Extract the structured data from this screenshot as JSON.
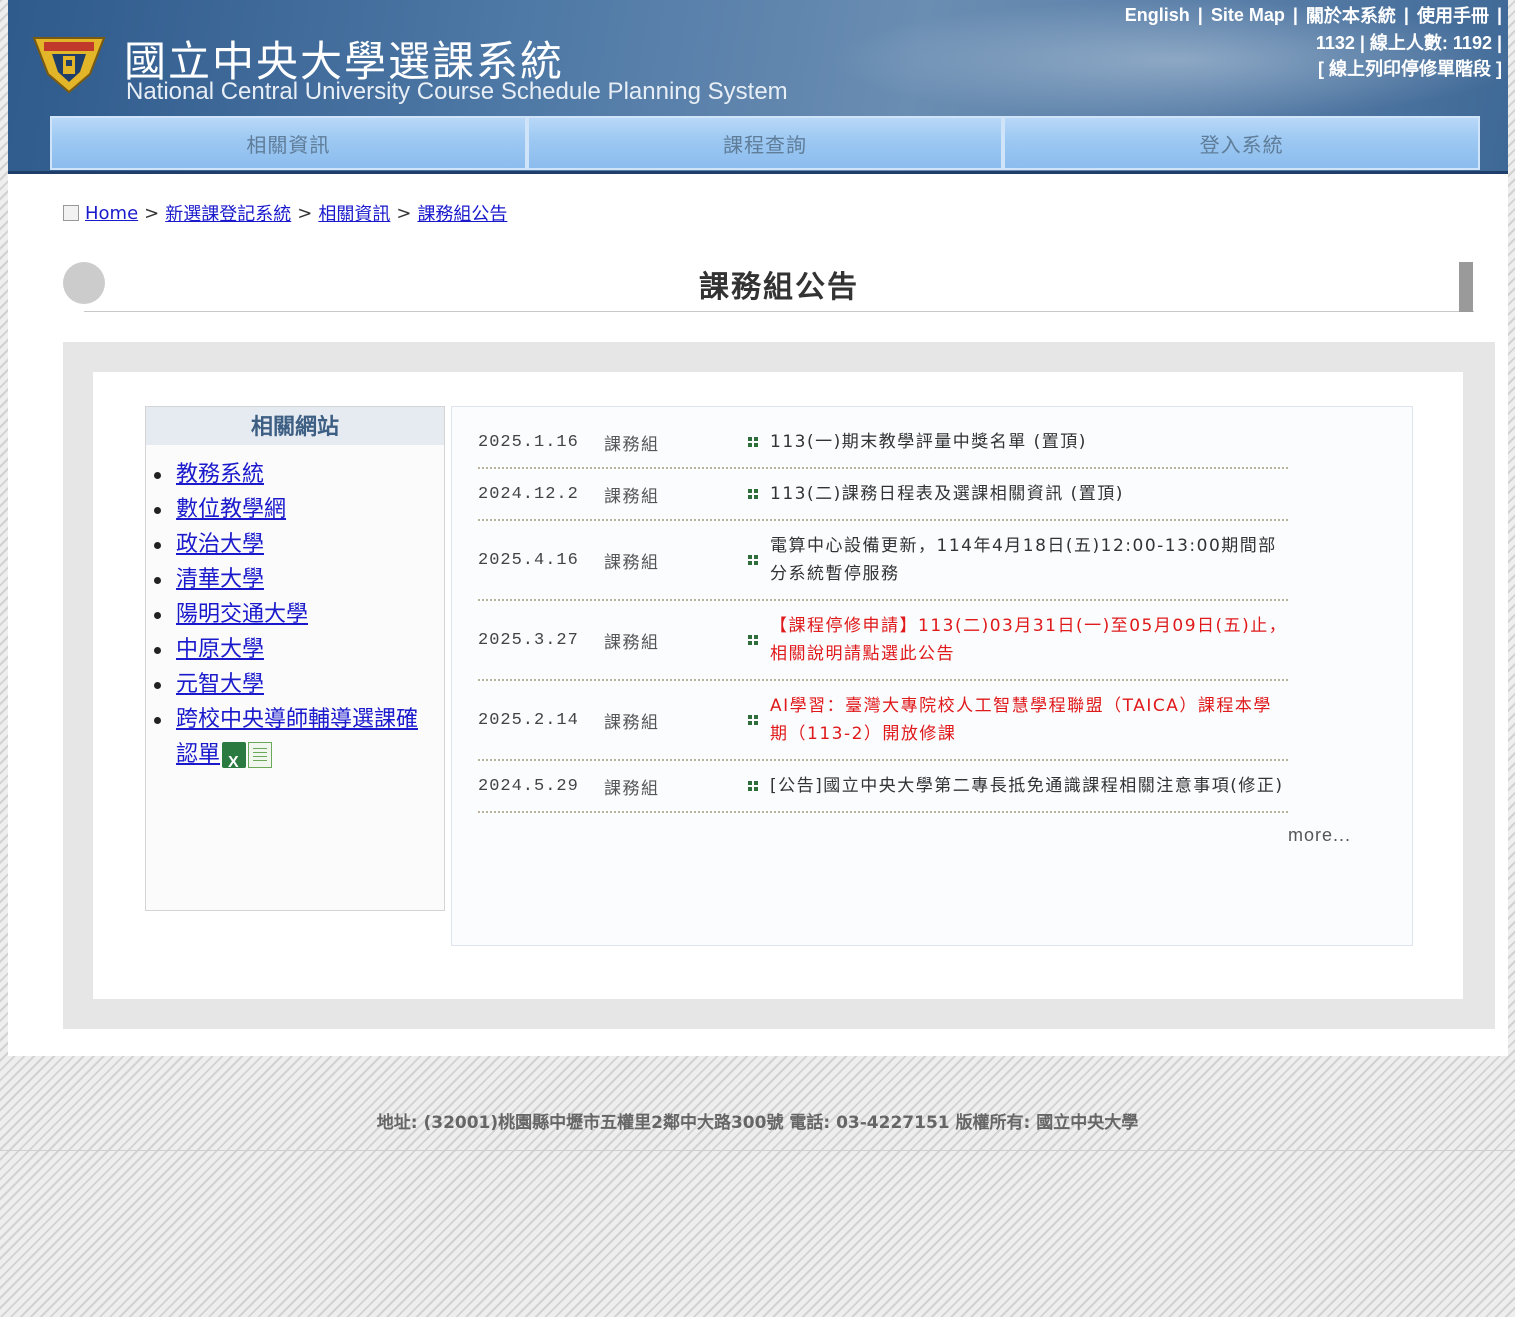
{
  "header": {
    "title_zh": "國立中央大學選課系統",
    "title_en": "National Central University Course Schedule Planning System",
    "toplinks": [
      "English",
      "Site Map",
      "關於本系統",
      "使用手冊"
    ],
    "stats_line1": "1132 | 線上人數: 1192 |",
    "stats_line2": "[ 線上列印停修單階段 ]"
  },
  "nav": {
    "tabs": [
      "相關資訊",
      "課程查詢",
      "登入系統"
    ]
  },
  "breadcrumb": {
    "items": [
      "Home",
      "新選課登記系統",
      "相關資訊",
      "課務組公告"
    ],
    "separator": ">"
  },
  "page": {
    "heading": "課務組公告"
  },
  "sidebar": {
    "title": "相關網站",
    "links": [
      "教務系統",
      "數位教學網",
      "政治大學",
      "清華大學",
      "陽明交通大學",
      "中原大學",
      "元智大學",
      "跨校中央導師輔導選課確認單"
    ],
    "icons": [
      "excel-icon",
      "spreadsheet-icon"
    ]
  },
  "news": {
    "items": [
      {
        "date": "2025.1.16",
        "dept": "課務組",
        "title": "113(一)期末教學評量中獎名單 (置頂)",
        "color": "#333333"
      },
      {
        "date": "2024.12.2",
        "dept": "課務組",
        "title": "113(二)課務日程表及選課相關資訊 (置頂)",
        "color": "#333333"
      },
      {
        "date": "2025.4.16",
        "dept": "課務組",
        "title": "電算中心設備更新，114年4月18日(五)12:00-13:00期間部分系統暫停服務",
        "color": "#333333"
      },
      {
        "date": "2025.3.27",
        "dept": "課務組",
        "title": "【課程停修申請】113(二)03月31日(一)至05月09日(五)止，相關說明請點選此公告",
        "color": "#e0191b"
      },
      {
        "date": "2025.2.14",
        "dept": "課務組",
        "title": "AI學習：臺灣大專院校人工智慧學程聯盟（TAICA）課程本學期（113-2）開放修課",
        "color": "#e0191b"
      },
      {
        "date": "2024.5.29",
        "dept": "課務組",
        "title": "[公告]國立中央大學第二專長抵免通識課程相關注意事項(修正)",
        "color": "#333333"
      }
    ],
    "more": "more..."
  },
  "footer": {
    "text": "地址: (32001)桃園縣中壢市五權里2鄰中大路300號 電話: 03-4227151 版權所有: 國立中央大學"
  }
}
